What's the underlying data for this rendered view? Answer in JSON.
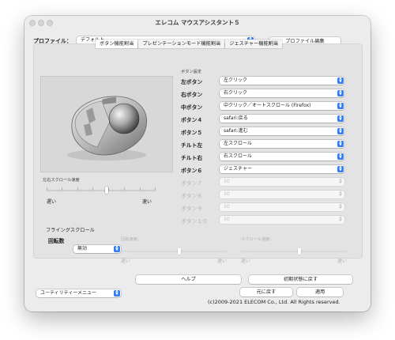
{
  "window": {
    "title": "エレコム マウスアシスタント５"
  },
  "profile": {
    "label": "プロファイル：",
    "value": "デフォルト",
    "edit_button": "プロファイル編集"
  },
  "tabs": [
    {
      "label": "ボタン機能割当",
      "active": true
    },
    {
      "label": "プレゼンテーションモード機能割当",
      "active": false
    },
    {
      "label": "ジェスチャー機能割当",
      "active": false
    }
  ],
  "button_settings": {
    "section_label": "ボタン設定",
    "rows": [
      {
        "label": "左ボタン",
        "value": "左クリック",
        "enabled": true
      },
      {
        "label": "右ボタン",
        "value": "右クリック",
        "enabled": true
      },
      {
        "label": "中ボタン",
        "value": "中クリック／オートスクロール (Firefox)",
        "enabled": true
      },
      {
        "label": "ボタン４",
        "value": "safari:戻る",
        "enabled": true
      },
      {
        "label": "ボタン５",
        "value": "safari:進む",
        "enabled": true
      },
      {
        "label": "チルト左",
        "value": "左スクロール",
        "enabled": true
      },
      {
        "label": "チルト右",
        "value": "右スクロール",
        "enabled": true
      },
      {
        "label": "ボタン６",
        "value": "ジェスチャー",
        "enabled": true
      },
      {
        "label": "ボタン７",
        "value": "10",
        "enabled": false
      },
      {
        "label": "ボタン８",
        "value": "10",
        "enabled": false
      },
      {
        "label": "ボタン９",
        "value": "10",
        "enabled": false
      },
      {
        "label": "ボタン１０",
        "value": "10",
        "enabled": false
      }
    ]
  },
  "horizontal_scroll": {
    "label": "左右スクロール速度",
    "slow": "遅い",
    "fast": "速い",
    "level": 0.55
  },
  "flying_scroll": {
    "section_label": "フライングスクロール",
    "rotation_label": "回転数",
    "rotation_value": "無効",
    "rotation_speed": {
      "label": "回転速度：",
      "slow": "遅い",
      "fast": "速い",
      "level": 0.55
    },
    "scroll_speed": {
      "label": "スクロール速度：",
      "slow": "遅い",
      "fast": "速い",
      "level": 0.55
    }
  },
  "footer": {
    "help_button": "ヘルプ",
    "reset_button": "初期状態に戻す",
    "utility_menu": "ユーティリティーメニュー",
    "revert_button": "元に戻す",
    "apply_button": "適用",
    "copyright": "(c)2009-2021 ELECOM Co., Ltd. All Rights reserved."
  },
  "colors": {
    "accent": "#2f7cf6",
    "window_bg": "#ececec",
    "panel_bg": "#e3e3e3"
  }
}
